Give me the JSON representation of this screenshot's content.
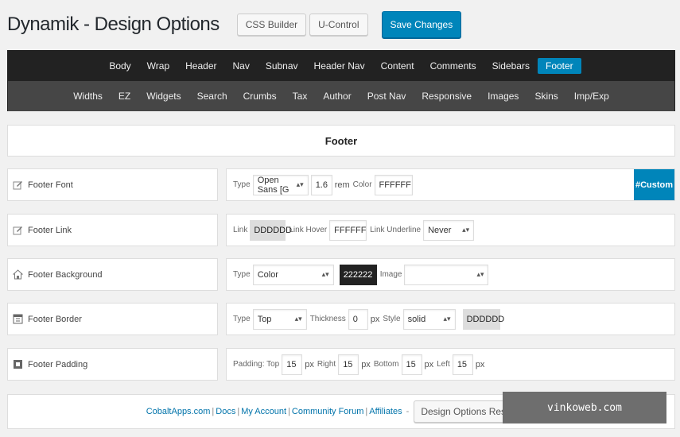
{
  "header": {
    "title": "Dynamik - Design Options",
    "css_builder": "CSS Builder",
    "u_control": "U-Control",
    "save": "Save Changes"
  },
  "nav": {
    "top": [
      "Body",
      "Wrap",
      "Header",
      "Nav",
      "Subnav",
      "Header Nav",
      "Content",
      "Comments",
      "Sidebars",
      "Footer"
    ],
    "bottom": [
      "Widths",
      "EZ",
      "Widgets",
      "Search",
      "Crumbs",
      "Tax",
      "Author",
      "Post Nav",
      "Responsive",
      "Images",
      "Skins",
      "Imp/Exp"
    ],
    "active": "Footer"
  },
  "section_title": "Footer",
  "rows": {
    "font": {
      "label": "Footer Font",
      "type_label": "Type",
      "type_value": "Open Sans [G",
      "size": "1.6",
      "unit": "rem",
      "color_label": "Color",
      "color": "FFFFFF",
      "custom": "#Custom"
    },
    "link": {
      "label": "Footer Link",
      "link_label": "Link",
      "link_color": "DDDDDD",
      "hover_label": "Link Hover",
      "hover_color": "FFFFFF",
      "underline_label": "Link Underline",
      "underline_value": "Never"
    },
    "background": {
      "label": "Footer Background",
      "type_label": "Type",
      "type_value": "Color",
      "color": "222222",
      "image_label": "Image",
      "image_value": ""
    },
    "border": {
      "label": "Footer Border",
      "type_label": "Type",
      "type_value": "Top",
      "thickness_label": "Thickness",
      "thickness": "0",
      "unit": "px",
      "style_label": "Style",
      "style_value": "solid",
      "color": "DDDDDD"
    },
    "padding": {
      "label": "Footer Padding",
      "top_label": "Padding: Top",
      "top": "15",
      "right_label": "Right",
      "right": "15",
      "bottom_label": "Bottom",
      "bottom": "15",
      "left_label": "Left",
      "left": "15",
      "unit": "px"
    }
  },
  "footer_links": {
    "cobalt": "CobaltApps.com",
    "docs": "Docs",
    "account": "My Account",
    "forum": "Community Forum",
    "affiliates": "Affiliates",
    "dash": "-",
    "reset": "Design Options Reset",
    "help": "[?]"
  },
  "watermark": "vinkoweb.com",
  "colors": {
    "accent": "#0085ba",
    "nav_dark": "#222222",
    "nav_mid": "#464646"
  }
}
